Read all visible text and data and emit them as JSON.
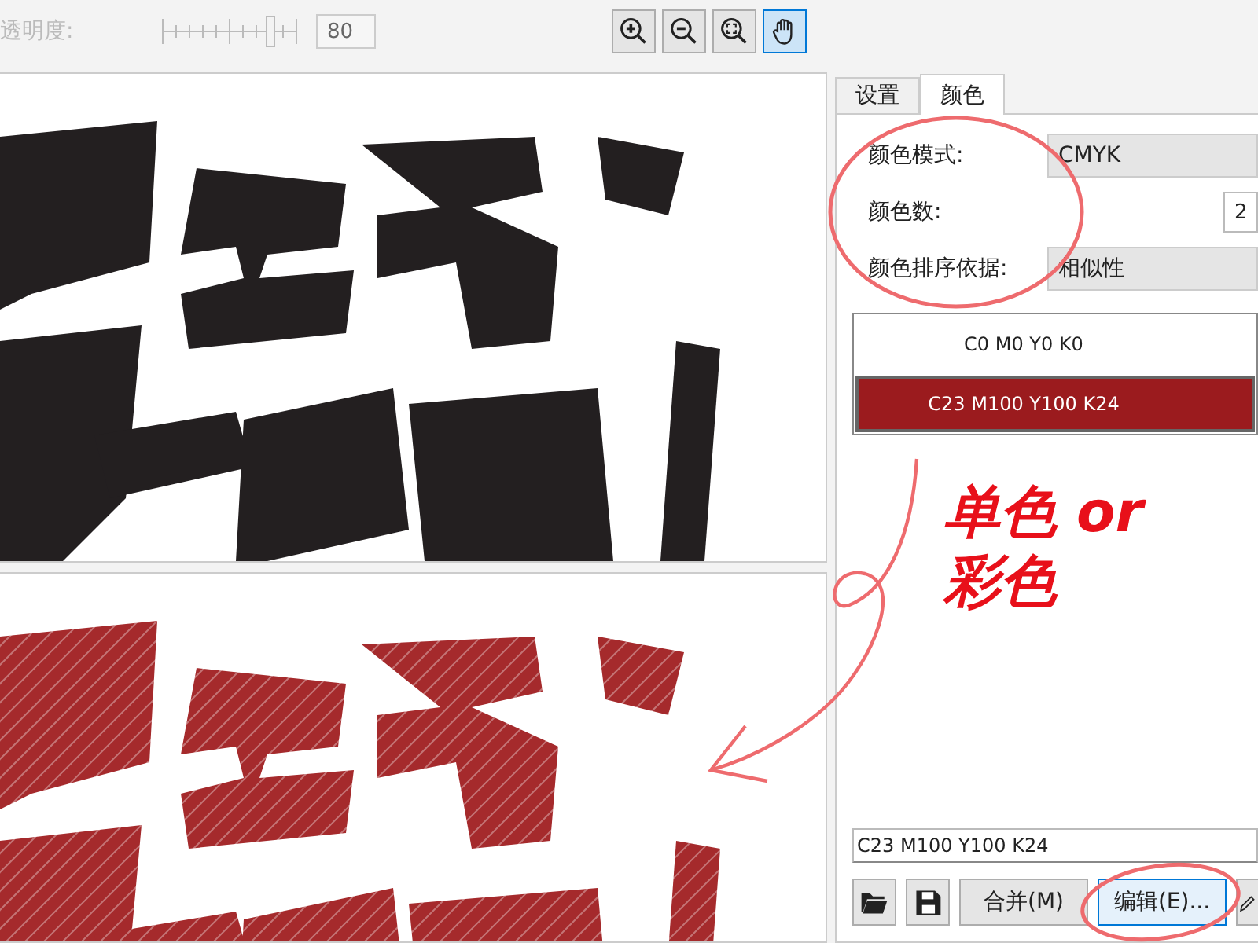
{
  "toolbar": {
    "transparency": {
      "label": "透明度:",
      "disabled": true,
      "level": 0.8,
      "value": "80"
    },
    "tools": [
      {
        "kind": "zoom-in",
        "selected": false
      },
      {
        "kind": "zoom-out",
        "selected": false
      },
      {
        "kind": "zoom-fit",
        "selected": false
      },
      {
        "kind": "pan",
        "selected": true
      }
    ]
  },
  "previews": [
    {
      "kind": "original"
    },
    {
      "kind": "traced"
    }
  ],
  "panel": {
    "tabs": [
      {
        "label": "设置",
        "selected": false
      },
      {
        "label": "颜色",
        "selected": true
      }
    ],
    "fields": [
      {
        "label": "颜色模式:",
        "kind": "dropdown",
        "value": "CMYK"
      },
      {
        "label": "颜色数:",
        "kind": "spinner",
        "value": "2"
      },
      {
        "label": "颜色排序依据:",
        "kind": "dropdown",
        "value": "相似性"
      }
    ],
    "colors": [
      {
        "label": "C0 M0 Y0 K0",
        "color": "#ffffff",
        "selected": false
      },
      {
        "label": "C23 M100 Y100 K24",
        "color": "#9b1b1e",
        "selected": true
      }
    ],
    "color_name": "C23 M100 Y100 K24",
    "buttons": [
      {
        "kind": "open",
        "highlighted": false
      },
      {
        "kind": "save",
        "highlighted": false
      },
      {
        "kind": "text",
        "label": "合并(M)",
        "highlighted": false
      },
      {
        "kind": "text",
        "label": "编辑(E)...",
        "highlighted": true
      },
      {
        "kind": "pen",
        "highlighted": false
      }
    ]
  },
  "annotation": {
    "note": [
      "单色 or",
      "彩色"
    ]
  }
}
